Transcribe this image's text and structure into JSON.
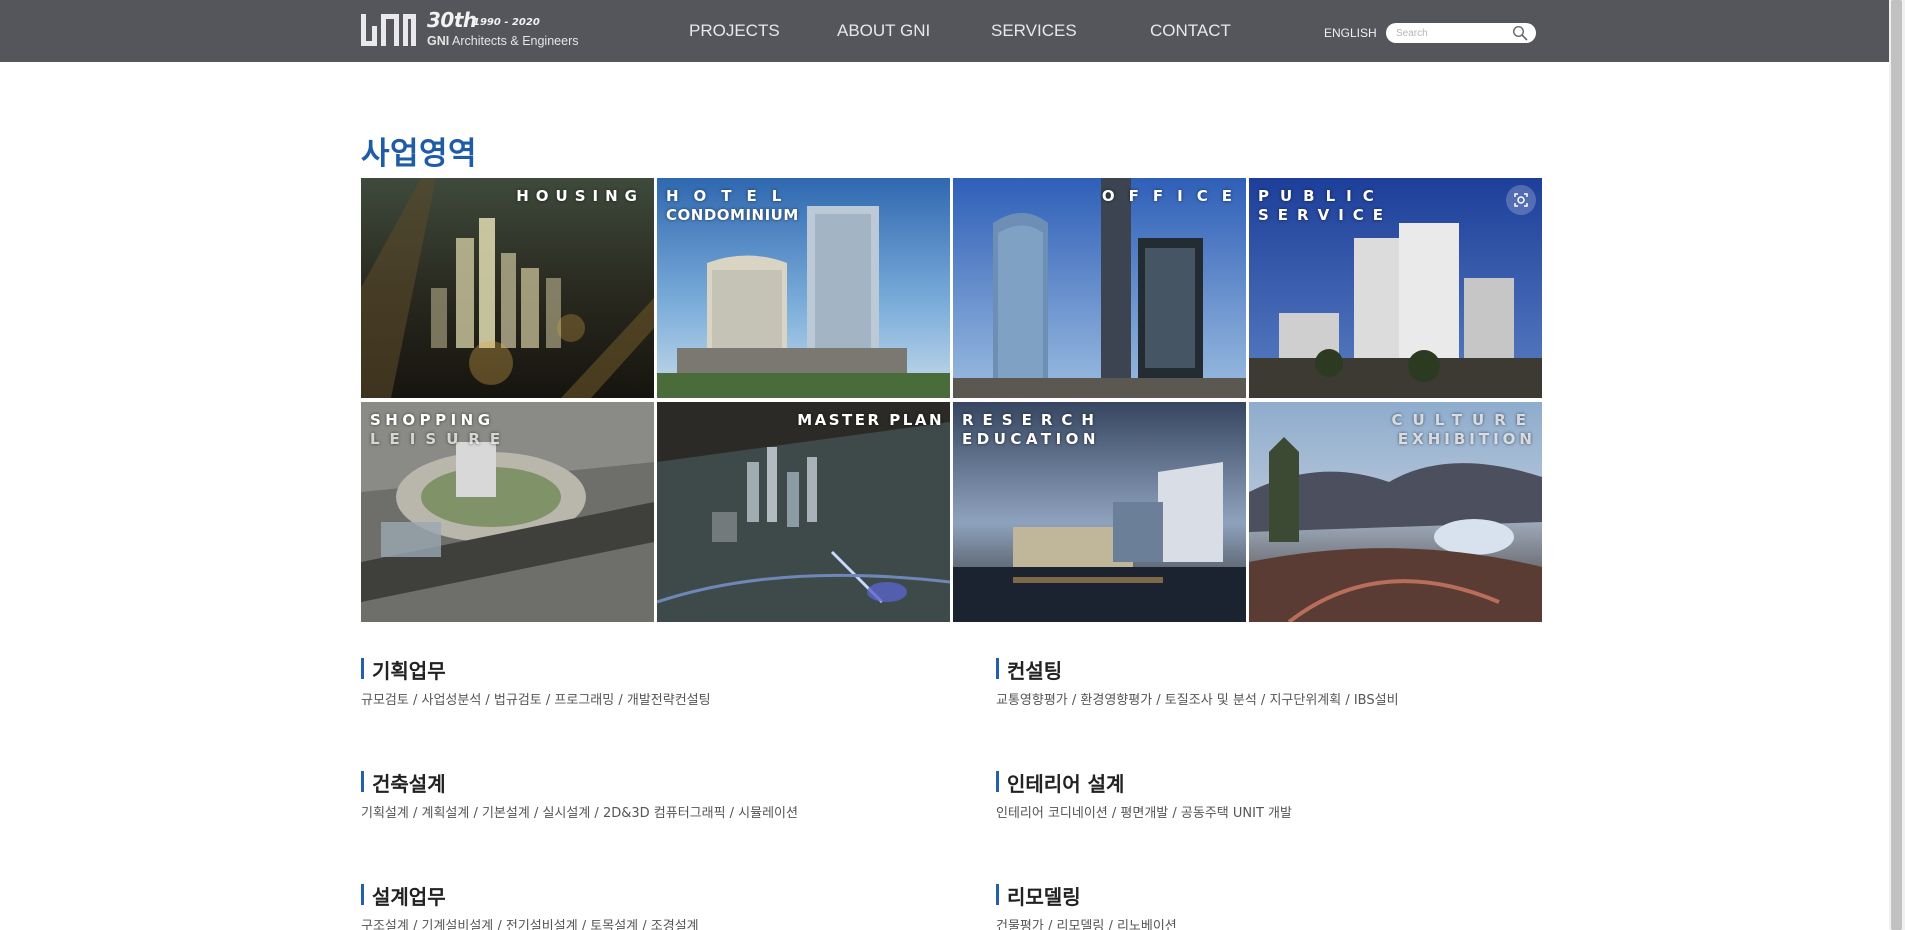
{
  "header": {
    "logo": {
      "anniversary": "30th",
      "years": "1990 - 2020",
      "company_short": "GNI",
      "company_rest": "Architects & Engineers"
    },
    "nav": [
      {
        "label": "PROJECTS"
      },
      {
        "label": "ABOUT GNI"
      },
      {
        "label": "SERVICES"
      },
      {
        "label": "CONTACT"
      }
    ],
    "language": "ENGLISH",
    "search": {
      "placeholder": "Search",
      "value": ""
    }
  },
  "main": {
    "title": "사업영역",
    "tiles": [
      {
        "line1": "HOUSING",
        "line2": ""
      },
      {
        "line1": "HOTEL",
        "line2": "CONDOMINIUM"
      },
      {
        "line1": "OFFICE",
        "line2": ""
      },
      {
        "line1": "PUBLIC",
        "line2": "SERVICE"
      },
      {
        "line1": "SHOPPING",
        "line2": "LEISURE"
      },
      {
        "line1": "MASTER PLAN",
        "line2": ""
      },
      {
        "line1": "RESERCH",
        "line2": "EDUCATION"
      },
      {
        "line1": "CULTURE",
        "line2": "EXHIBITION"
      }
    ],
    "services": [
      {
        "title": "기획업무",
        "desc": "규모검토 / 사업성분석 / 법규검토 / 프로그래밍 / 개발전략컨설팅"
      },
      {
        "title": "컨설팅",
        "desc": "교통영향평가 / 환경영향평가 / 토질조사 및 분석 / 지구단위계획 / IBS설비"
      },
      {
        "title": "건축설계",
        "desc": "기획설계 / 계획설계 / 기본설계 / 실시설계 / 2D&3D 컴퓨터그래픽 / 시뮬레이션"
      },
      {
        "title": "인테리어 설계",
        "desc": "인테리어 코디네이션 / 평면개발 / 공동주택 UNIT 개발"
      },
      {
        "title": "설계업무",
        "desc": "구조설계 / 기계설비설계 / 전기설비설계 / 토목설계 / 조경설계"
      },
      {
        "title": "리모델링",
        "desc": "건물평가 / 리모델링 / 리노베이션"
      }
    ]
  },
  "colors": {
    "header_bg": "#55555c",
    "title_blue": "#1f5ca8",
    "accent_bar": "#2360ac"
  },
  "icons": {
    "search": "magnifier-icon",
    "lens": "visual-search-icon"
  }
}
